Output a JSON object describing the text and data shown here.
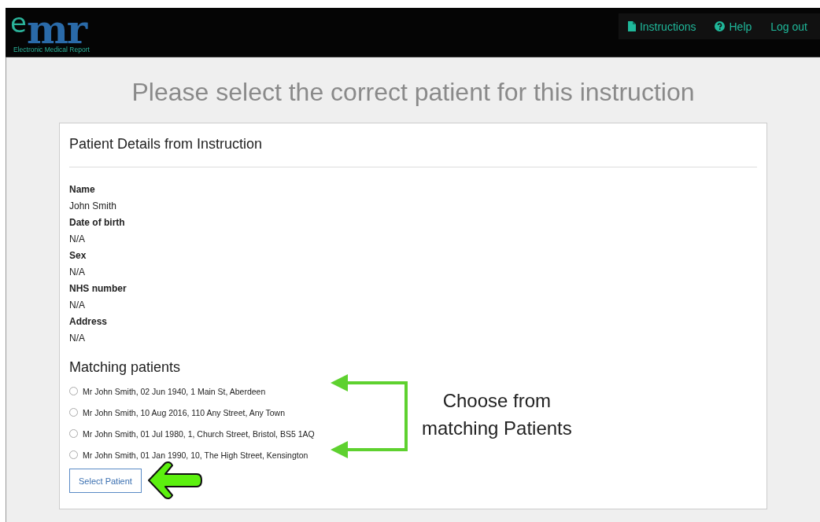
{
  "header": {
    "logo": {
      "letter_e": "e",
      "letters_mr": "mr",
      "tagline": "Electronic Medical Report"
    },
    "nav": [
      {
        "label": "Instructions",
        "kind": "document"
      },
      {
        "label": "Help",
        "kind": "help"
      },
      {
        "label": "Log out",
        "kind": "plain"
      }
    ]
  },
  "title": "Please select the correct patient for this instruction",
  "card": {
    "heading": "Patient Details from Instruction",
    "details": [
      {
        "label": "Name",
        "value": "John Smith"
      },
      {
        "label": "Date of birth",
        "value": "N/A"
      },
      {
        "label": "Sex",
        "value": "N/A"
      },
      {
        "label": "NHS number",
        "value": "N/A"
      },
      {
        "label": "Address",
        "value": "N/A"
      }
    ],
    "matching_heading": "Matching patients",
    "patients": [
      {
        "label": "Mr John Smith, 02 Jun 1940, 1 Main St, Aberdeen",
        "selected": false
      },
      {
        "label": "Mr John Smith, 10 Aug 2016, 110 Any Street, Any Town",
        "selected": false
      },
      {
        "label": "Mr John Smith, 01 Jul 1980, 1, Church Street, Bristol, BS5 1AQ",
        "selected": false
      },
      {
        "label": "Mr John Smith, 01 Jan 1990, 10, The High Street, Kensington",
        "selected": false
      }
    ],
    "button": "Select Patient"
  },
  "annotation": {
    "lines": [
      "Choose from",
      "matching Patients"
    ]
  }
}
